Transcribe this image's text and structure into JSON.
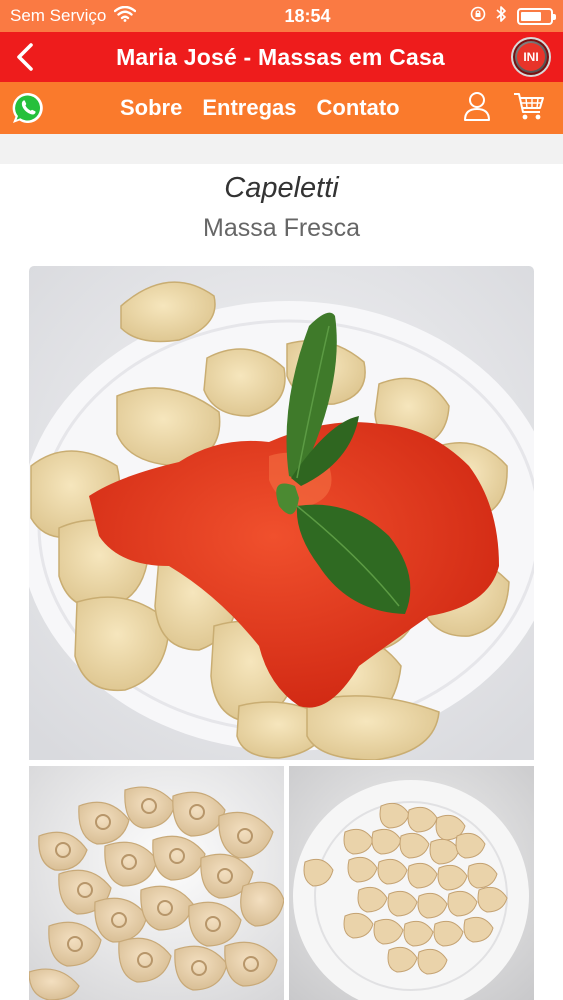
{
  "status_bar": {
    "carrier": "Sem Serviço",
    "time": "18:54",
    "battery_level": 0.72
  },
  "title_bar": {
    "title": "Maria José - Massas em Casa",
    "badge": "INI"
  },
  "nav": {
    "links": [
      "Sobre",
      "Entregas",
      "Contato"
    ]
  },
  "product": {
    "name": "Capeletti",
    "category": "Massa Fresca"
  },
  "colors": {
    "status_bar": "#fa7a43",
    "title_bar": "#ee1c1c",
    "nav_bar": "#fa7a2c"
  },
  "icons": [
    "wifi-icon",
    "lock-rotation-icon",
    "bluetooth-icon",
    "battery-icon",
    "back-chevron-icon",
    "whatsapp-icon",
    "user-icon",
    "cart-icon"
  ]
}
